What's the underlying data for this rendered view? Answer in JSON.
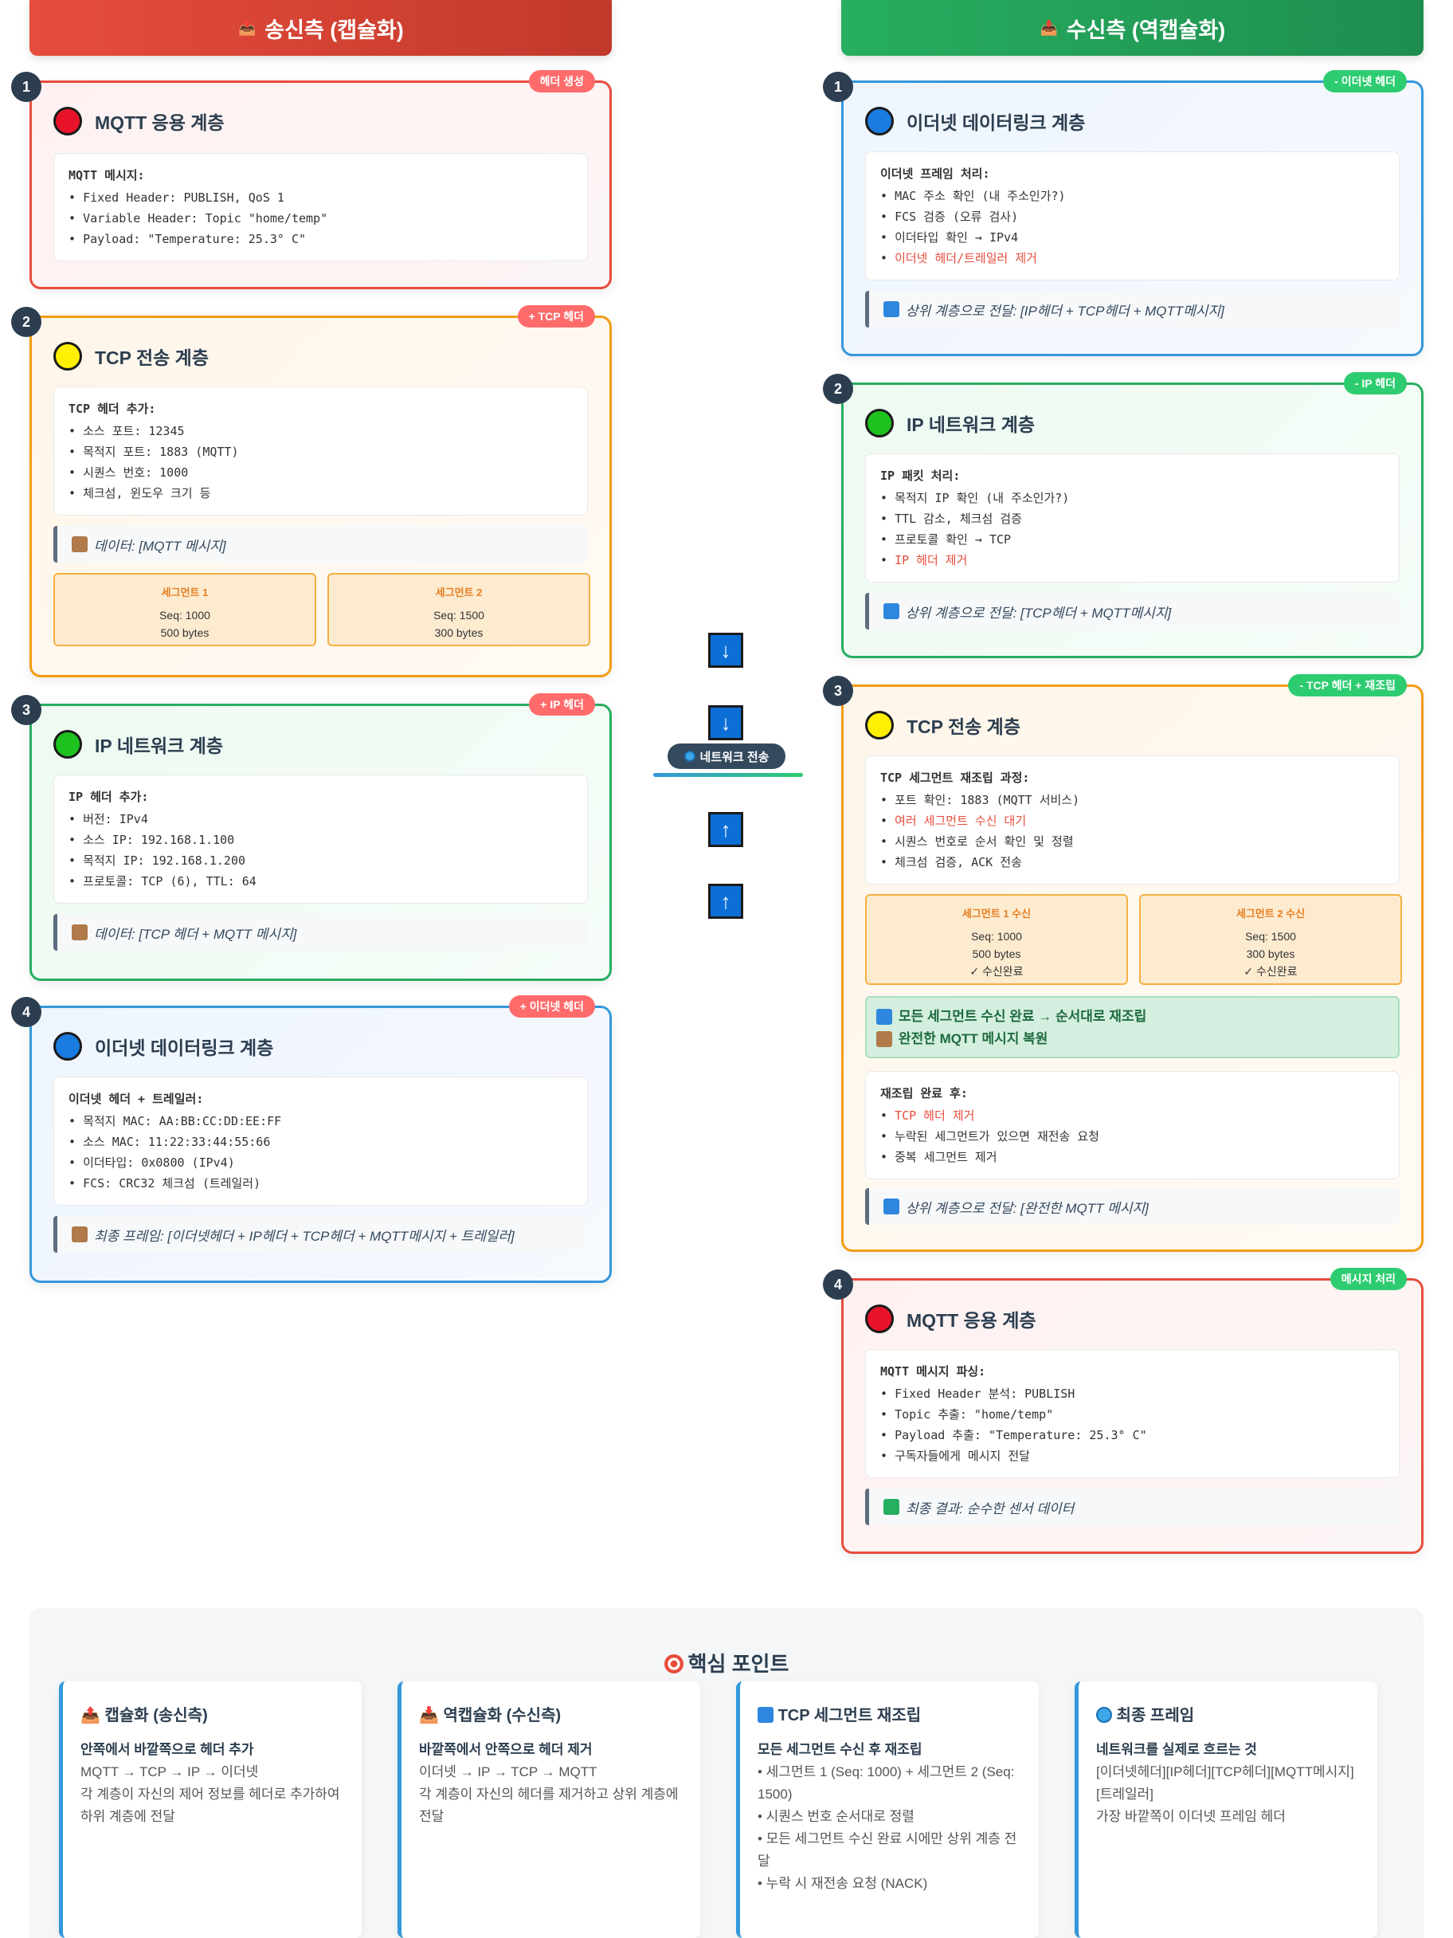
{
  "header": {
    "send_title": "송신측 (캡슐화)",
    "recv_title": "수신측 (역캡슐화)"
  },
  "sender": [
    {
      "num": "1",
      "tag": "헤더 생성",
      "title": "MQTT 응용 계층",
      "info_head": "MQTT 메시지:",
      "items": [
        "Fixed Header: PUBLISH, QoS 1",
        "Variable Header: Topic \"home/temp\"",
        "Payload: \"Temperature: 25.3° C\""
      ]
    },
    {
      "num": "2",
      "tag": "+ TCP 헤더",
      "title": "TCP 전송 계층",
      "info_head": "TCP 헤더 추가:",
      "items": [
        "소스 포트: 12345",
        "목적지 포트: 1883 (MQTT)",
        "시퀀스 번호: 1000",
        "체크섬, 윈도우 크기 등"
      ],
      "note": "데이터: [MQTT 메시지]",
      "segments": [
        {
          "title": "세그먼트 1",
          "seq": "Seq: 1000",
          "size": "500 bytes"
        },
        {
          "title": "세그먼트 2",
          "seq": "Seq: 1500",
          "size": "300 bytes"
        }
      ]
    },
    {
      "num": "3",
      "tag": "+ IP 헤더",
      "title": "IP 네트워크 계층",
      "info_head": "IP 헤더 추가:",
      "items": [
        "버전: IPv4",
        "소스 IP: 192.168.1.100",
        "목적지 IP: 192.168.1.200",
        "프로토콜: TCP (6), TTL: 64"
      ],
      "note": "데이터: [TCP 헤더 + MQTT 메시지]"
    },
    {
      "num": "4",
      "tag": "+ 이더넷 헤더",
      "title": "이더넷 데이터링크 계층",
      "info_head": "이더넷 헤더 + 트레일러:",
      "items": [
        "목적지 MAC: AA:BB:CC:DD:EE:FF",
        "소스 MAC: 11:22:33:44:55:66",
        "이더타입: 0x0800 (IPv4)",
        "FCS: CRC32 체크섬 (트레일러)"
      ],
      "note": "최종 프레임: [이더넷헤더 + IP헤더 + TCP헤더 + MQTT메시지 + 트레일러]"
    }
  ],
  "receiver": [
    {
      "num": "1",
      "tag": "- 이더넷 헤더",
      "title": "이더넷 데이터링크 계층",
      "info_head": "이더넷 프레임 처리:",
      "items": [
        "MAC 주소 확인 (내 주소인가?)",
        "FCS 검증 (오류 검사)",
        "이더타입 확인 → IPv4",
        "이더넷 헤더/트레일러 제거"
      ],
      "note": "상위 계층으로 전달: [IP헤더 + TCP헤더 + MQTT메시지]"
    },
    {
      "num": "2",
      "tag": "- IP 헤더",
      "title": "IP 네트워크 계층",
      "info_head": "IP 패킷 처리:",
      "items": [
        "목적지 IP 확인 (내 주소인가?)",
        "TTL 감소, 체크섬 검증",
        "프로토콜 확인 → TCP",
        "IP 헤더 제거"
      ],
      "note": "상위 계층으로 전달: [TCP헤더 + MQTT메시지]"
    },
    {
      "num": "3",
      "tag": "- TCP 헤더 + 재조립",
      "title": "TCP 전송 계층",
      "info_head": "TCP 세그먼트 재조립 과정:",
      "items": [
        "포트 확인: 1883 (MQTT 서비스)",
        "여러 세그먼트 수신 대기",
        "시퀀스 번호로 순서 확인 및 정렬",
        "체크섬 검증, ACK 전송"
      ],
      "segments": [
        {
          "title": "세그먼트 1 수신",
          "seq": "Seq: 1000",
          "size": "500 bytes",
          "status": "✓ 수신완료"
        },
        {
          "title": "세그먼트 2 수신",
          "seq": "Seq: 1500",
          "size": "300 bytes",
          "status": "✓ 수신완료"
        }
      ],
      "done_1": "모든 세그먼트 수신 완료 → 순서대로 재조립",
      "done_2": "완전한 MQTT 메시지 복원",
      "info2_head": "재조립 완료 후:",
      "items2": [
        "TCP 헤더 제거",
        "누락된 세그먼트가 있으면 재전송 요청",
        "중복 세그먼트 제거"
      ],
      "note": "상위 계층으로 전달: [완전한 MQTT 메시지]"
    },
    {
      "num": "4",
      "tag": "메시지 처리",
      "title": "MQTT 응용 계층",
      "info_head": "MQTT 메시지 파싱:",
      "items": [
        "Fixed Header 분석: PUBLISH",
        "Topic 추출: \"home/temp\"",
        "Payload 추출: \"Temperature: 25.3° C\"",
        "구독자들에게 메시지 전달"
      ],
      "note": "최종 결과: 순수한 센서 데이터"
    }
  ],
  "middle": {
    "down_arrow": "↓",
    "up_arrow": "↑",
    "label": "네트워크 전송"
  },
  "summary": {
    "title": "핵심 포인트",
    "cards": [
      {
        "title": "캡슐화 (송신측)",
        "bold": "안쪽에서 바깥쪽으로 헤더 추가",
        "lines": [
          "MQTT → TCP → IP → 이더넷",
          "각 계층이 자신의 제어 정보를 헤더로 추가하여 하위 계층에 전달"
        ]
      },
      {
        "title": "역캡슐화 (수신측)",
        "bold": "바깥쪽에서 안쪽으로 헤더 제거",
        "lines": [
          "이더넷 → IP → TCP → MQTT",
          "각 계층이 자신의 헤더를 제거하고 상위 계층에 전달"
        ]
      },
      {
        "title": "TCP 세그먼트 재조립",
        "bold": "모든 세그먼트 수신 후 재조립",
        "lines": [
          "• 세그먼트 1 (Seq: 1000) + 세그먼트 2 (Seq: 1500)",
          "• 시퀀스 번호 순서대로 정렬",
          "• 모든 세그먼트 수신 완료 시에만 상위 계층 전달",
          "• 누락 시 재전송 요청 (NACK)"
        ]
      },
      {
        "title": "최종 프레임",
        "bold": "네트워크를 실제로 흐르는 것",
        "lines": [
          "[이더넷헤더][IP헤더][TCP헤더][MQTT메시지][트레일러]",
          "가장 바깥쪽이 이더넷 프레임 헤더"
        ]
      }
    ]
  },
  "colors": {
    "send": "#e74c3c",
    "recv": "#27ae60",
    "network": "#34495e"
  }
}
